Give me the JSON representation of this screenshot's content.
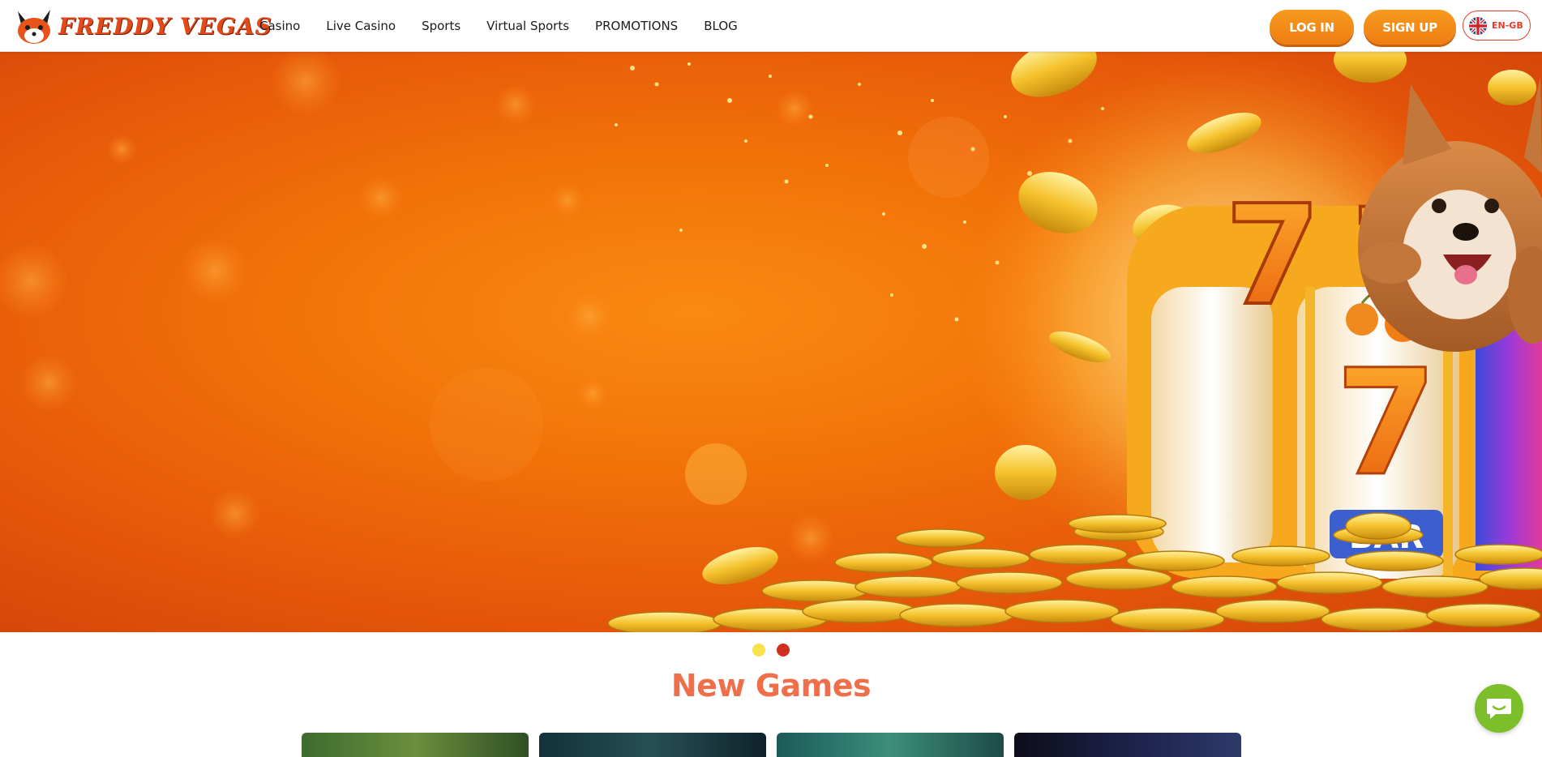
{
  "header": {
    "logo_text": "FREDDY VEGAS",
    "nav": [
      "Casino",
      "Live Casino",
      "Sports",
      "Virtual Sports",
      "PROMOTIONS",
      "BLOG"
    ],
    "login_label": "LOG IN",
    "signup_label": "SIGN UP",
    "language": "EN-GB"
  },
  "hero": {
    "carousel_total": 2,
    "carousel_active": 2,
    "reel_symbol": "7",
    "bar_symbol": "BAR"
  },
  "new_games": {
    "title": "New Games"
  },
  "colors": {
    "accent_orange": "#ef7d12",
    "title_coral": "#ef6f4a",
    "chat_green": "#7cbf2b",
    "dot_yellow": "#f7e24a",
    "dot_red": "#d2301f"
  },
  "icons": [
    "fox-logo-icon",
    "uk-flag-icon",
    "chat-icon"
  ]
}
